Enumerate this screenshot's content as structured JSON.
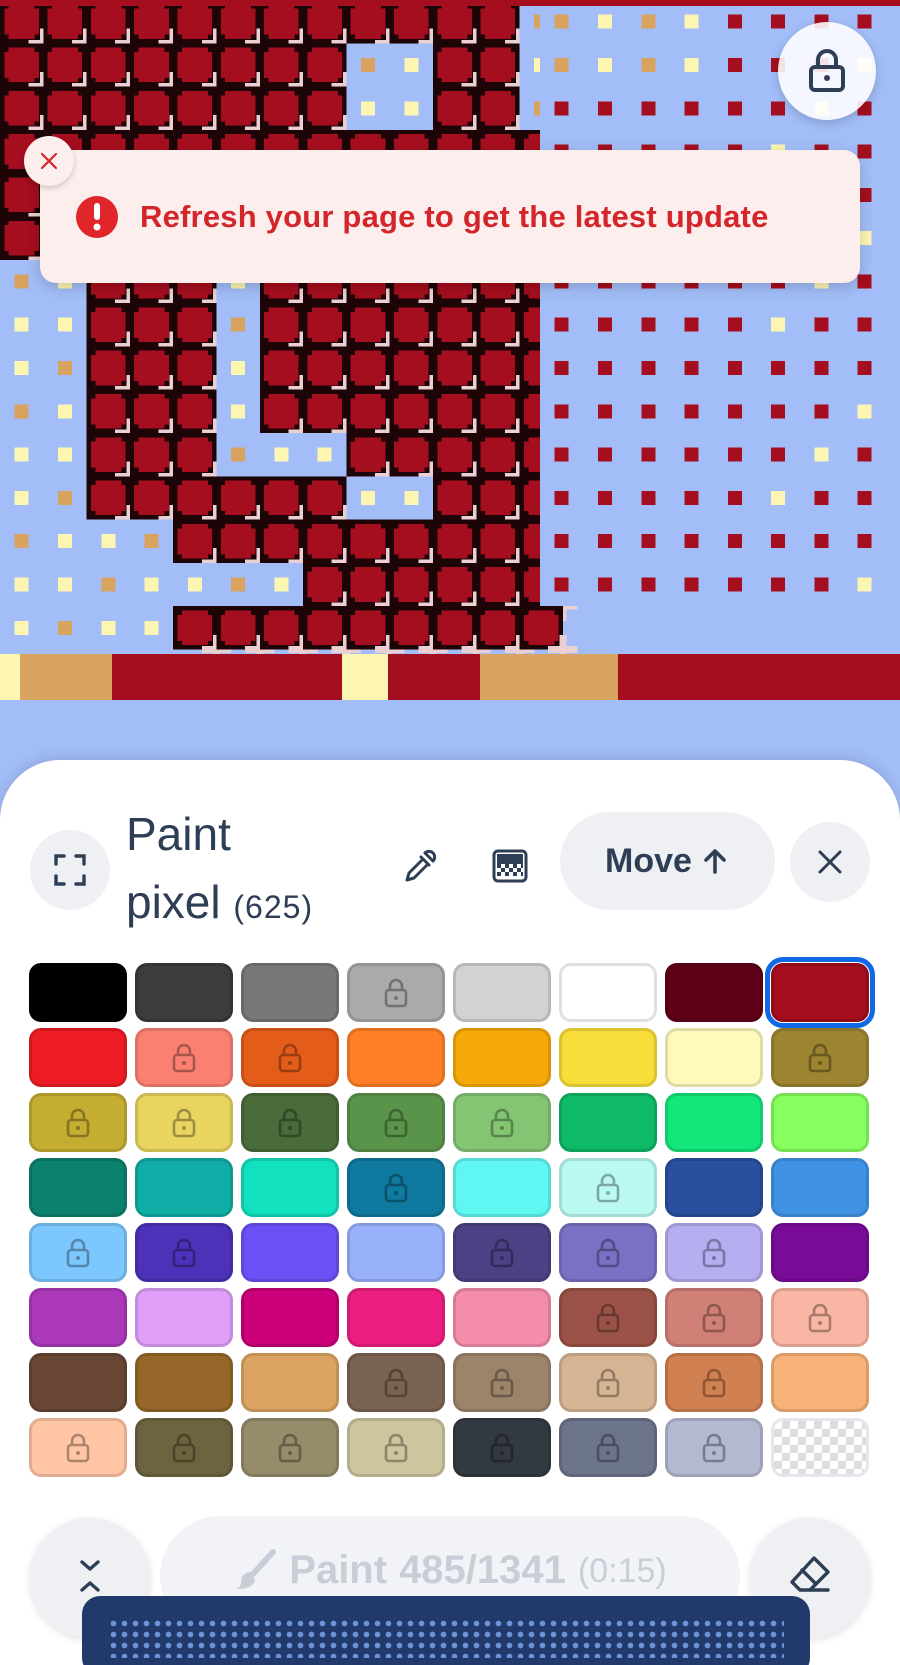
{
  "toast": {
    "message": "Refresh your page to get the latest update",
    "icon": "exclamation-icon",
    "close_icon": "close-icon"
  },
  "canvas": {
    "colors": {
      "sky": "#a2bdf8",
      "red": "#a50e1e",
      "dark": "#1d0406",
      "pink": "#ead0d2",
      "cream": "#fdf6b3",
      "tan": "#d7a35f"
    },
    "lock_icon": "lock-icon"
  },
  "panel": {
    "title_line1": "Paint",
    "title_line2": "pixel",
    "count": "(625)",
    "move_label": "Move",
    "icons": [
      "fullscreen-icon",
      "eyedropper-icon",
      "pattern-icon",
      "arrow-up-icon",
      "close-icon"
    ]
  },
  "palette": [
    {
      "color": "#000000",
      "locked": false
    },
    {
      "color": "#3c3c3c",
      "locked": false
    },
    {
      "color": "#787878",
      "locked": false
    },
    {
      "color": "#aaaaaa",
      "locked": true
    },
    {
      "color": "#d2d2d2",
      "locked": false
    },
    {
      "color": "#ffffff",
      "locked": false
    },
    {
      "color": "#600018",
      "locked": false
    },
    {
      "color": "#a50e1e",
      "locked": false,
      "selected": true
    },
    {
      "color": "#ed1c24",
      "locked": false
    },
    {
      "color": "#fa8072",
      "locked": true
    },
    {
      "color": "#e45c1a",
      "locked": true
    },
    {
      "color": "#ff7f27",
      "locked": false
    },
    {
      "color": "#f6aa09",
      "locked": false
    },
    {
      "color": "#f9dd3b",
      "locked": false
    },
    {
      "color": "#fffabc",
      "locked": false
    },
    {
      "color": "#9c8431",
      "locked": true
    },
    {
      "color": "#c5ad31",
      "locked": true
    },
    {
      "color": "#e8d45f",
      "locked": true
    },
    {
      "color": "#4a6b3a",
      "locked": true
    },
    {
      "color": "#5a944a",
      "locked": true
    },
    {
      "color": "#84c573",
      "locked": true
    },
    {
      "color": "#0eb968",
      "locked": false
    },
    {
      "color": "#13e67b",
      "locked": false
    },
    {
      "color": "#87ff5e",
      "locked": false
    },
    {
      "color": "#0c816e",
      "locked": false
    },
    {
      "color": "#10aea6",
      "locked": false
    },
    {
      "color": "#13e1be",
      "locked": false
    },
    {
      "color": "#0f799f",
      "locked": true
    },
    {
      "color": "#60f7f2",
      "locked": false
    },
    {
      "color": "#bbfaf2",
      "locked": true
    },
    {
      "color": "#28509e",
      "locked": false
    },
    {
      "color": "#4093e4",
      "locked": false
    },
    {
      "color": "#7dc7ff",
      "locked": true
    },
    {
      "color": "#4d31b8",
      "locked": true
    },
    {
      "color": "#6b50f6",
      "locked": false
    },
    {
      "color": "#99b1fb",
      "locked": false
    },
    {
      "color": "#4a4284",
      "locked": true
    },
    {
      "color": "#7a71c4",
      "locked": true
    },
    {
      "color": "#b5aef1",
      "locked": true
    },
    {
      "color": "#780c99",
      "locked": false
    },
    {
      "color": "#aa38b9",
      "locked": false
    },
    {
      "color": "#e09ff9",
      "locked": false
    },
    {
      "color": "#cb007a",
      "locked": false
    },
    {
      "color": "#ec1f80",
      "locked": false
    },
    {
      "color": "#f38da9",
      "locked": false
    },
    {
      "color": "#9b5249",
      "locked": true
    },
    {
      "color": "#d18078",
      "locked": true
    },
    {
      "color": "#fab6a4",
      "locked": true
    },
    {
      "color": "#684634",
      "locked": false
    },
    {
      "color": "#95682a",
      "locked": false
    },
    {
      "color": "#dba463",
      "locked": false
    },
    {
      "color": "#7b6352",
      "locked": true
    },
    {
      "color": "#9c846b",
      "locked": true
    },
    {
      "color": "#d6b594",
      "locked": true
    },
    {
      "color": "#d18051",
      "locked": true
    },
    {
      "color": "#f8b277",
      "locked": false
    },
    {
      "color": "#ffc5a5",
      "locked": true
    },
    {
      "color": "#6d643f",
      "locked": true
    },
    {
      "color": "#948c6b",
      "locked": true
    },
    {
      "color": "#cdc59e",
      "locked": true
    },
    {
      "color": "#333941",
      "locked": true
    },
    {
      "color": "#6d758d",
      "locked": true
    },
    {
      "color": "#b3b9d1",
      "locked": true
    },
    {
      "color": "transparent",
      "locked": false
    }
  ],
  "footer": {
    "paint_label": "Paint",
    "charges": "485/1341",
    "cooldown": "(0:15)",
    "icons": [
      "collapse-icon",
      "brush-icon",
      "eraser-icon"
    ]
  }
}
